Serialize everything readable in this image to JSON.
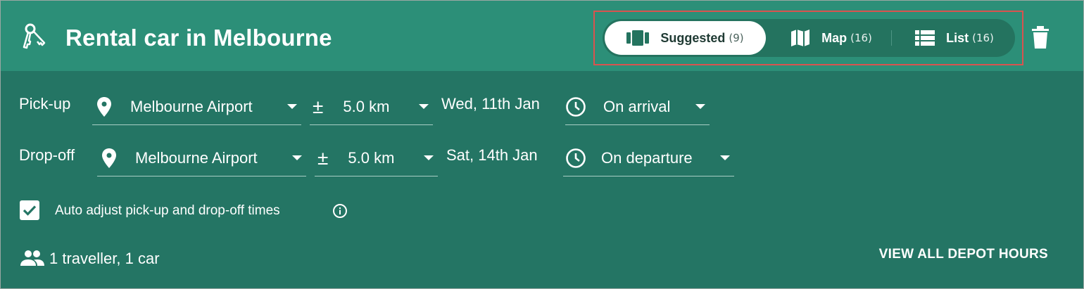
{
  "header": {
    "title": "Rental car in Melbourne",
    "icon": "car-keys-icon",
    "view_tabs": [
      {
        "label": "Suggested",
        "count": "(9)",
        "icon": "cards-icon",
        "selected": true
      },
      {
        "label": "Map",
        "count": "(16)",
        "icon": "map-icon",
        "selected": false
      },
      {
        "label": "List",
        "count": "(16)",
        "icon": "list-icon",
        "selected": false
      }
    ],
    "delete_icon": "trash-icon"
  },
  "pickup": {
    "label": "Pick-up",
    "location": "Melbourne Airport",
    "radius": "5.0 km",
    "date": "Wed, 11th Jan",
    "time": "On arrival"
  },
  "dropoff": {
    "label": "Drop-off",
    "location": "Melbourne Airport",
    "radius": "5.0 km",
    "date": "Sat, 14th Jan",
    "time": "On departure"
  },
  "auto_adjust": {
    "label": "Auto adjust pick-up and drop-off times",
    "checked": true
  },
  "travellers": "1 traveller, 1 car",
  "depot_link": "VIEW ALL DEPOT HOURS",
  "colors": {
    "header_bg": "#2c8f78",
    "body_bg": "#247564",
    "highlight_border": "#d9534f",
    "selected_tab_bg": "#ffffff"
  }
}
